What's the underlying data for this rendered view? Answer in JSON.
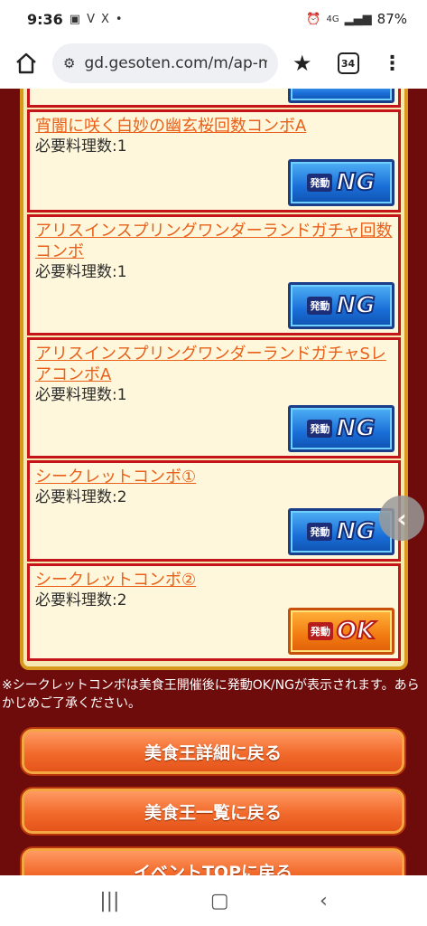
{
  "status_bar": {
    "time": "9:36",
    "signal": "4G",
    "battery": "87%"
  },
  "browser": {
    "url": "gd.gesoten.com/m/ap-m",
    "tab_count": "34"
  },
  "combos": [
    {
      "title": "宵闇に咲く白妙の幽玄桜回数コンボA",
      "requirement": "必要料理数:1",
      "status_prefix": "発動",
      "status": "NG"
    },
    {
      "title": "アリスインスプリングワンダーランドガチャ回数コンボ",
      "requirement": "必要料理数:1",
      "status_prefix": "発動",
      "status": "NG"
    },
    {
      "title": "アリスインスプリングワンダーランドガチャSレアコンボA",
      "requirement": "必要料理数:1",
      "status_prefix": "発動",
      "status": "NG"
    },
    {
      "title": "シークレットコンボ①",
      "requirement": "必要料理数:2",
      "status_prefix": "発動",
      "status": "NG"
    },
    {
      "title": "シークレットコンボ②",
      "requirement": "必要料理数:2",
      "status_prefix": "発動",
      "status": "OK"
    }
  ],
  "notice": "※シークレットコンボは美食王開催後に発動OK/NGが表示されます。あらかじめご了承ください。",
  "buttons": {
    "detail": "美食王詳細に戻る",
    "list": "美食王一覧に戻る",
    "event_top": "イベントTOPに戻る"
  },
  "colors": {
    "background": "#6e0b0b",
    "link": "#e8601a",
    "ng_badge": "#1a6ed8",
    "ok_badge": "#f27b12",
    "button": "#f26a2c"
  }
}
